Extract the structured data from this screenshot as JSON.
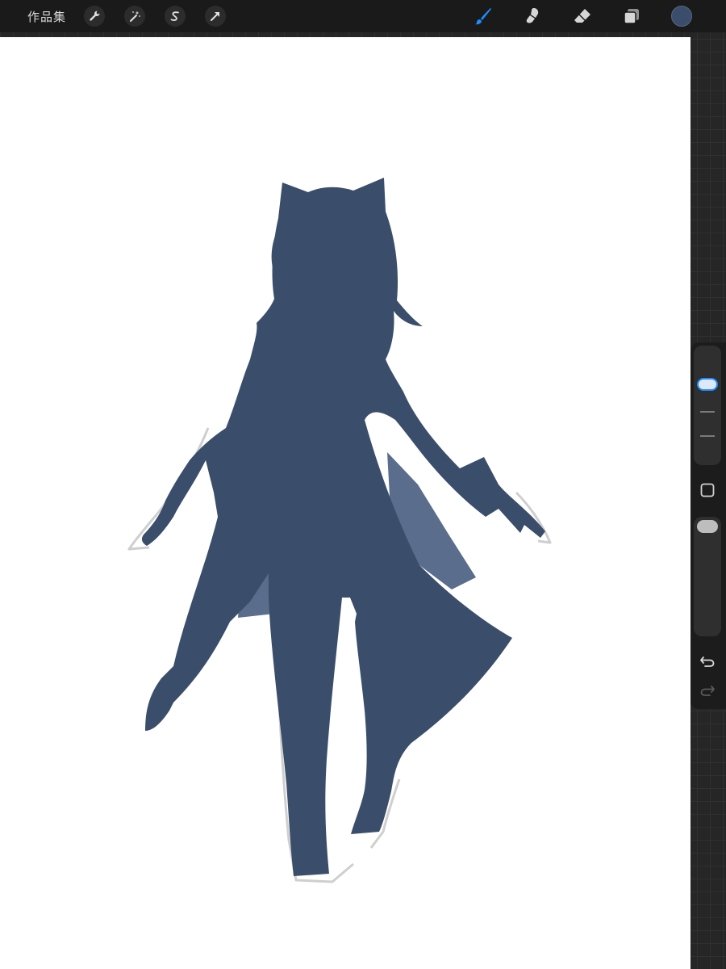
{
  "topbar": {
    "gallery_label": "作品集",
    "left_tools": [
      {
        "name": "actions-wrench-icon"
      },
      {
        "name": "adjustments-magic-wand-icon"
      },
      {
        "name": "selection-s-icon"
      },
      {
        "name": "transform-arrow-icon"
      }
    ],
    "right_tools": [
      {
        "name": "brush-icon",
        "active": true
      },
      {
        "name": "smudge-icon",
        "active": false
      },
      {
        "name": "eraser-icon",
        "active": false
      },
      {
        "name": "layers-icon",
        "active": false
      }
    ],
    "current_color": "#3a4d6a"
  },
  "colors": {
    "accent": "#1e8cff",
    "silhouette": "#3a4d6a",
    "sketch": "#cfcfcf"
  },
  "sidebar": {
    "brush_size_level": 0.9,
    "opacity_level": 1.0,
    "tools": [
      "modify-square-icon",
      "undo-icon",
      "redo-icon"
    ]
  }
}
